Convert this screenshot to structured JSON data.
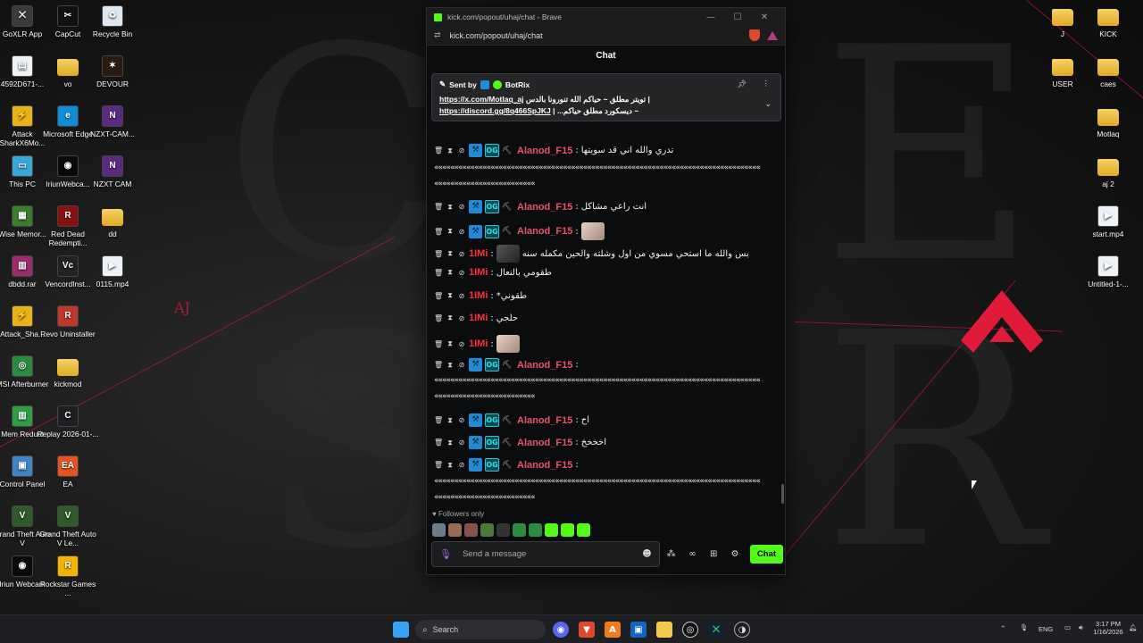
{
  "desktop": {
    "left_icons": [
      {
        "label": "GoXLR App",
        "glyph": "⨉",
        "color": "#3b3b3b"
      },
      {
        "label": "CapCut",
        "glyph": "✂",
        "color": "#111111"
      },
      {
        "label": "Recycle Bin",
        "glyph": "♻",
        "color": "#dfe8f2"
      },
      {
        "label": "4592D671-...",
        "glyph": "▤",
        "color": "#eef2f7"
      },
      {
        "label": "vo",
        "glyph": "",
        "color": "folder"
      },
      {
        "label": "DEVOUR",
        "glyph": "✶",
        "color": "#2a1a10"
      },
      {
        "label": "Attack SharkX6Mo...",
        "glyph": "⚡",
        "color": "#e9b21c"
      },
      {
        "label": "Microsoft Edge",
        "glyph": "e",
        "color": "#0f8dd6"
      },
      {
        "label": "NZXT-CAM...",
        "glyph": "N",
        "color": "#5a2a82"
      },
      {
        "label": "This PC",
        "glyph": "▭",
        "color": "#39a7d8"
      },
      {
        "label": "IriunWebca...",
        "glyph": "◉",
        "color": "#0a0a0a"
      },
      {
        "label": "NZXT CAM",
        "glyph": "N",
        "color": "#5a2a82"
      },
      {
        "label": "Wise Memor...",
        "glyph": "▦",
        "color": "#3a7d2a"
      },
      {
        "label": "Red Dead Redempti...",
        "glyph": "R",
        "color": "#8a1010"
      },
      {
        "label": "dd",
        "glyph": "",
        "color": "folder"
      },
      {
        "label": "dbdd.rar",
        "glyph": "▥",
        "color": "#9b2b6a"
      },
      {
        "label": "VencordInst...",
        "glyph": "Vc",
        "color": "#222222"
      },
      {
        "label": "0115.mp4",
        "glyph": "▶",
        "color": "#eef2f7"
      },
      {
        "label": "Attack_Sha...",
        "glyph": "⚡",
        "color": "#e9b21c"
      },
      {
        "label": "Revo Uninstaller",
        "glyph": "R",
        "color": "#c0392b"
      },
      {
        "label": "MSI Afterburner",
        "glyph": "◎",
        "color": "#2b8a3e"
      },
      {
        "label": "kickmod",
        "glyph": "",
        "color": "folder"
      },
      {
        "label": "Mem Reduct",
        "glyph": "▥",
        "color": "#2e9e44"
      },
      {
        "label": "Replay 2026-01-...",
        "glyph": "C",
        "color": "#1d1f22"
      },
      {
        "label": "Control Panel",
        "glyph": "▣",
        "color": "#3d86c6"
      },
      {
        "label": "EA",
        "glyph": "EA",
        "color": "#e8531f"
      },
      {
        "label": "Grand Theft Auto V",
        "glyph": "V",
        "color": "#2f5a2a"
      },
      {
        "label": "Grand Theft Auto V Le...",
        "glyph": "V",
        "color": "#2f5a2a"
      },
      {
        "label": "Iriun Webcam",
        "glyph": "◉",
        "color": "#0a0a0a"
      },
      {
        "label": "Rockstar Games ...",
        "glyph": "R",
        "color": "#f2b400"
      }
    ],
    "right_icons": [
      {
        "label": "J",
        "glyph": "",
        "color": "folder"
      },
      {
        "label": "KICK",
        "glyph": "",
        "color": "folder"
      },
      {
        "label": "USER",
        "glyph": "",
        "color": "folder"
      },
      {
        "label": "caes",
        "glyph": "",
        "color": "folder"
      },
      {
        "label": "Motlaq",
        "glyph": "",
        "color": "folder"
      },
      {
        "label": "aj 2",
        "glyph": "",
        "color": "folder"
      },
      {
        "label": "start.mp4",
        "glyph": "▶",
        "color": "#eef2f7"
      },
      {
        "label": "Untitled-1-...",
        "glyph": "▶",
        "color": "#eef2f7"
      }
    ],
    "wallpaper_mark": "AJ"
  },
  "browser": {
    "window_title": "kick.com/popout/uhaj/chat - Brave",
    "url": "kick.com/popout/uhaj/chat",
    "minimize": "—",
    "maximize": "☐",
    "close": "✕"
  },
  "chat": {
    "header": "Chat",
    "pinned": {
      "sent_by": "Sent by",
      "sender": "BotRix",
      "line1_link": "https://x.com/Motlaq_aj",
      "line1_text": "تويتر مطلق ~ حياكم الله تنورونا بالدس |",
      "line2_link": "https://discord.gg/8q466SpJKJ",
      "line2_text": "| ...ديسكورد مطلق حياكم ~"
    },
    "messages": [
      {
        "user": "Alanod_F15",
        "text": "تدري والله اني قد سويتها",
        "emote": ""
      },
      {
        "user": "Alanod_F15",
        "text": "انت راعي مشاكل",
        "emote": ""
      },
      {
        "user": "Alanod_F15",
        "text": "",
        "emote": "face"
      },
      {
        "user": "1IMi",
        "text": "بس والله ما استحي مسوي من اول وشلته والحين مكمله سنه",
        "emote": "dark"
      },
      {
        "user": "1IMi",
        "text": "طقومي بالنعال",
        "emote": ""
      },
      {
        "user": "1IMi",
        "text": "*طقوني",
        "emote": ""
      },
      {
        "user": "1IMi",
        "text": "حلجي",
        "emote": ""
      },
      {
        "user": "1IMi",
        "text": "",
        "emote": "face"
      },
      {
        "user": "Alanod_F15",
        "text": "",
        "emote": ""
      },
      {
        "user": "Alanod_F15",
        "text": "اح",
        "emote": ""
      },
      {
        "user": "Alanod_F15",
        "text": "اخخخخ",
        "emote": ""
      },
      {
        "user": "Alanod_F15",
        "text": "",
        "emote": ""
      }
    ],
    "spam_text": "«««««««««««««««««««««««««««««««««««««««««««««««««««««««««««««««««««««««««««««««««",
    "spam_tail": "«««««««««««««««««««««««««",
    "followers_only": "Followers only",
    "input_placeholder": "Send a message",
    "send_label": "Chat"
  },
  "taskbar": {
    "search_label": "Search",
    "language": "ENG",
    "time": "3:17 PM",
    "date": "1/16/2026"
  },
  "colors": {
    "kick_green": "#53fc18",
    "alanod_name": "#e9546b",
    "imi_name": "#ff2f3a",
    "accent_red": "#b3183a"
  }
}
